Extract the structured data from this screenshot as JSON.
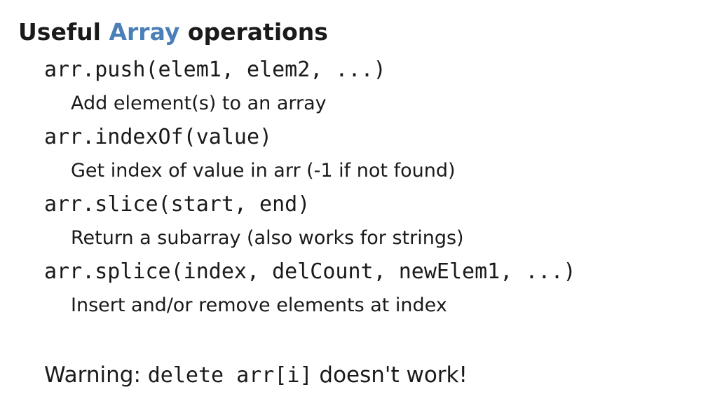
{
  "title": {
    "prefix": "Useful ",
    "highlight": "Array",
    "suffix": " operations"
  },
  "operations": [
    {
      "signature": "arr.push(elem1, elem2, ...)",
      "description": "Add element(s) to an array"
    },
    {
      "signature": "arr.indexOf(value)",
      "description": "Get index of value in arr (-1 if not found)"
    },
    {
      "signature": "arr.slice(start, end)",
      "description": "Return a subarray (also works for strings)"
    },
    {
      "signature": "arr.splice(index, delCount, newElem1, ...)",
      "description": "Insert and/or remove elements at index"
    }
  ],
  "warning": {
    "prefix": "Warning: ",
    "code": "delete arr[i]",
    "suffix": " doesn't work!"
  },
  "colors": {
    "accent": "#4a7fb8",
    "text": "#1a1a1a",
    "background": "#ffffff"
  }
}
